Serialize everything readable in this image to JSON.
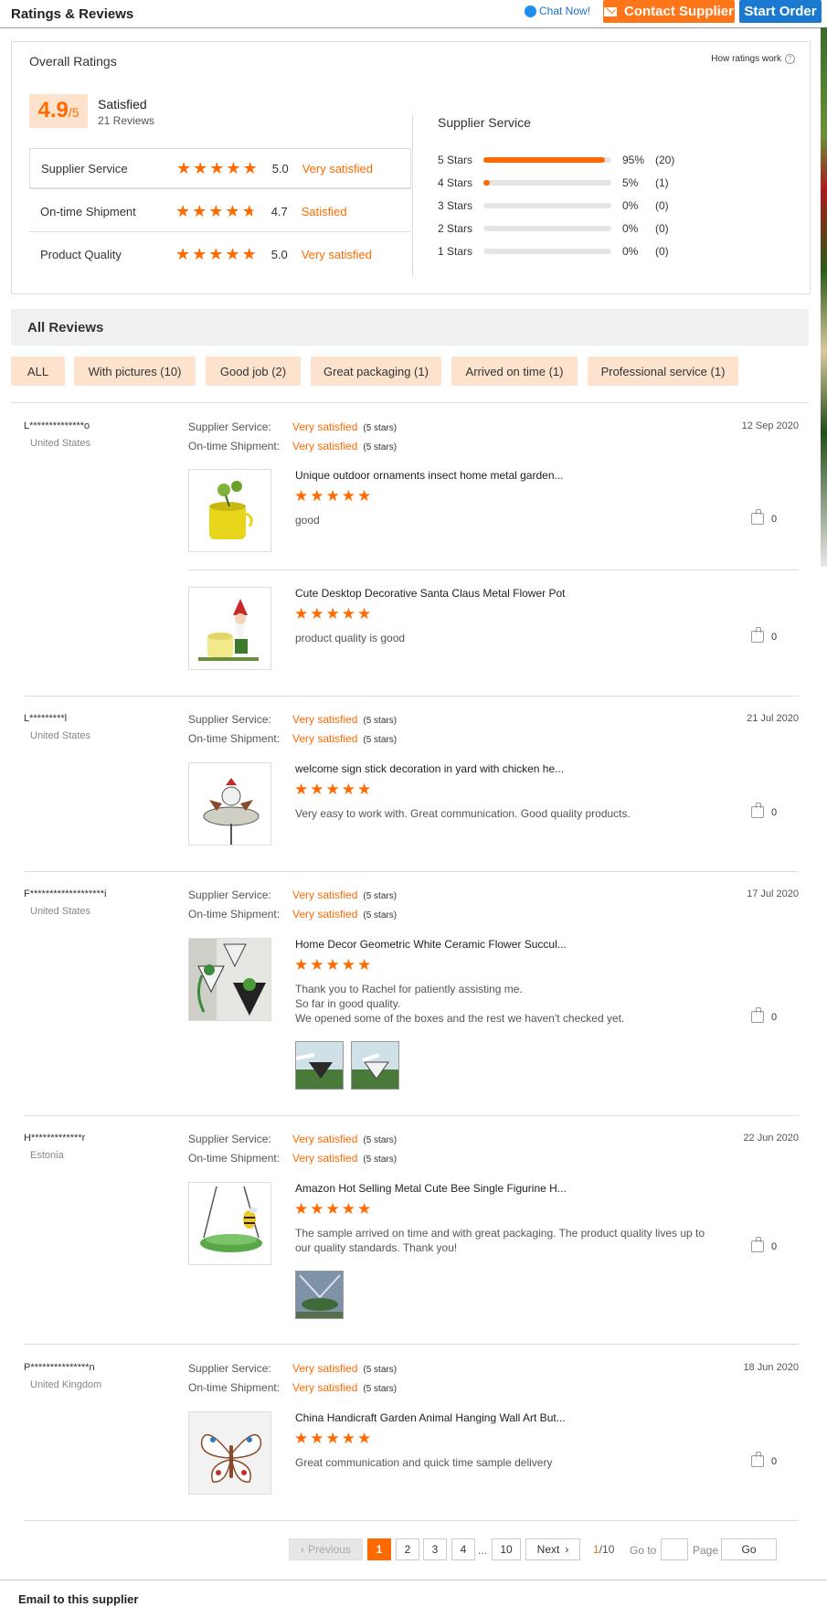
{
  "header": {
    "title": "Ratings & Reviews",
    "chat_label": "Chat Now!",
    "contact_label": "Contact Supplier",
    "order_label": "Start Order"
  },
  "overall": {
    "heading": "Overall Ratings",
    "how_label": "How ratings work",
    "score": "4.9",
    "score_suffix": "/5",
    "level": "Satisfied",
    "reviews_count": "21 Reviews",
    "criteria": [
      {
        "label": "Supplier Service",
        "stars": 5.0,
        "value": "5.0",
        "desc": "Very satisfied"
      },
      {
        "label": "On-time Shipment",
        "stars": 4.7,
        "value": "4.7",
        "desc": "Satisfied"
      },
      {
        "label": "Product Quality",
        "stars": 5.0,
        "value": "5.0",
        "desc": "Very satisfied"
      }
    ],
    "breakdown_title": "Supplier Service",
    "breakdown": [
      {
        "label": "5 Stars",
        "percent": 95,
        "pct_text": "95%",
        "count": "(20)"
      },
      {
        "label": "4 Stars",
        "percent": 5,
        "pct_text": "5%",
        "count": "(1)"
      },
      {
        "label": "3 Stars",
        "percent": 0,
        "pct_text": "0%",
        "count": "(0)"
      },
      {
        "label": "2 Stars",
        "percent": 0,
        "pct_text": "0%",
        "count": "(0)"
      },
      {
        "label": "1 Stars",
        "percent": 0,
        "pct_text": "0%",
        "count": "(0)"
      }
    ]
  },
  "all_reviews": {
    "heading": "All Reviews",
    "filters": [
      "ALL",
      "With pictures (10)",
      "Good job (2)",
      "Great packaging (1)",
      "Arrived on time (1)",
      "Professional service (1)"
    ]
  },
  "labels": {
    "supplier_service": "Supplier Service:",
    "ontime_shipment": "On-time Shipment:",
    "very_satisfied": "Very satisfied",
    "five_stars": "(5 stars)"
  },
  "reviews": [
    {
      "user": "L**************o",
      "country": "United States",
      "date": "12 Sep 2020",
      "items": [
        {
          "title": "Unique outdoor ornaments insect home metal garden...",
          "comment": "good",
          "likes": "0"
        },
        {
          "title": "Cute Desktop Decorative Santa Claus Metal Flower Pot",
          "comment": "product quality is good",
          "likes": "0"
        }
      ]
    },
    {
      "user": "L*********l",
      "country": "United States",
      "date": "21 Jul 2020",
      "items": [
        {
          "title": "welcome sign stick decoration in yard with chicken he...",
          "comment": "Very easy to work with. Great communication. Good quality products.",
          "likes": "0"
        }
      ]
    },
    {
      "user": "F*******************i",
      "country": "United States",
      "date": "17 Jul 2020",
      "items": [
        {
          "title": "Home Decor Geometric White Ceramic Flower Succul...",
          "comment_lines": [
            "Thank you to Rachel for patiently assisting me.",
            "So far in good quality.",
            "We opened some of the boxes and the rest we haven't checked yet."
          ],
          "likes": "0"
        }
      ]
    },
    {
      "user": "H*************r",
      "country": "Estonia",
      "date": "22 Jun 2020",
      "items": [
        {
          "title": "Amazon Hot Selling Metal Cute Bee Single Figurine H...",
          "comment": "The sample arrived on time and with great packaging. The product quality lives up to our quality standards. Thank you!",
          "likes": "0"
        }
      ]
    },
    {
      "user": "P***************n",
      "country": "United Kingdom",
      "date": "18 Jun 2020",
      "items": [
        {
          "title": "China Handicraft Garden Animal Hanging Wall Art But...",
          "comment": "Great communication and quick time sample delivery",
          "likes": "0"
        }
      ]
    }
  ],
  "pagination": {
    "previous": "Previous",
    "pages": [
      "1",
      "2",
      "3",
      "4"
    ],
    "ellipsis": "...",
    "last": "10",
    "next": "Next",
    "current": "1",
    "total": "/10",
    "goto": "Go to",
    "page": "Page",
    "go": "Go"
  },
  "footer": {
    "email_title": "Email to this supplier"
  },
  "colors": {
    "accent": "#ff6a00",
    "chip_bg": "#fde2cd",
    "order_blue": "#1b7ad0"
  }
}
